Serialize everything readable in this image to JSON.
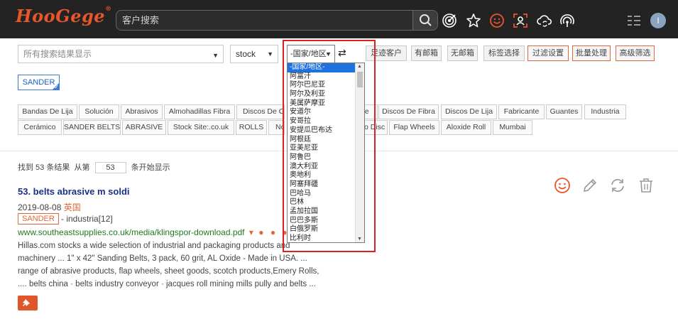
{
  "header": {
    "logo": "HooGege",
    "logo_mark": "®",
    "search_placeholder": "客户搜索",
    "avatar_letter": "I",
    "icons": [
      "search-icon",
      "target-icon",
      "star-icon",
      "smiley-icon",
      "face-scan-icon",
      "cloud-sync-icon",
      "signal-icon",
      "menu-icon"
    ]
  },
  "filters": {
    "result_display": "所有搜索结果显示",
    "stock": "stock",
    "country": "-国家/地区-",
    "swap_symbol": "⇄",
    "buttons": [
      "足迹客户",
      "有邮箱",
      "无邮箱",
      "标签选择",
      "过滤设置",
      "批量处理",
      "高级筛选"
    ]
  },
  "active_tag": "SANDER",
  "chips_row1": [
    "Bandas De Lija",
    "Solución",
    "Abrasivos",
    "Almohadillas Fibra",
    "Discos De Corte",
    "te",
    "Discos De Fibra",
    "Discos De Lija",
    "Fabricante",
    "Guantes",
    "Industria"
  ],
  "chips_row2": [
    "Cerámico",
    "SANDER BELTS",
    "ABRASIVE",
    "Stock Site:.co.uk",
    "ROLLS",
    "Nor",
    "o Disc",
    "Flap Wheels",
    "Aloxide Roll",
    "Mumbai"
  ],
  "results_info": {
    "found": "找到 53 条结果",
    "from_label": "从第",
    "from_value": "53",
    "start_label": "条开始显示"
  },
  "result": {
    "title": "53. belts abrasive m soldi",
    "date": "2019-08-08",
    "country": "英国",
    "tag": "SANDER",
    "tag_after": "- industria[12]",
    "url": "www.southeastsupplies.co.uk/media/klingspor-download.pdf",
    "url_caret": "▾",
    "url_dots": "● ● ●",
    "snippet": [
      "Hillas.com stocks a wide selection of industrial and packaging products and",
      "machinery ... 1\" x 42\" Sanding Belts, 3 pack, 60 grit, AL Oxide - Made in USA. ...",
      "range of abrasive products, flap wheels, sheet goods, scotch products,Emery Rolls,",
      ".... belts china · belts industry conveyor · jacques roll mining mills pully and belts ..."
    ]
  },
  "country_dropdown": [
    "-国家/地区-",
    "阿富汗",
    "阿尔巴尼亚",
    "阿尔及利亚",
    "美属萨摩亚",
    "安道尔",
    "安哥拉",
    "安提瓜巴布达",
    "阿根廷",
    "亚美尼亚",
    "阿鲁巴",
    "澳大利亚",
    "奥地利",
    "阿塞拜疆",
    "巴哈马",
    "巴林",
    "孟加拉国",
    "巴巴多斯",
    "白俄罗斯",
    "比利时"
  ],
  "colors": {
    "accent": "#e0683a",
    "header_bg": "#232323",
    "link": "#1a2e8a",
    "url": "#1f7a1f",
    "highlight": "#e02020"
  }
}
